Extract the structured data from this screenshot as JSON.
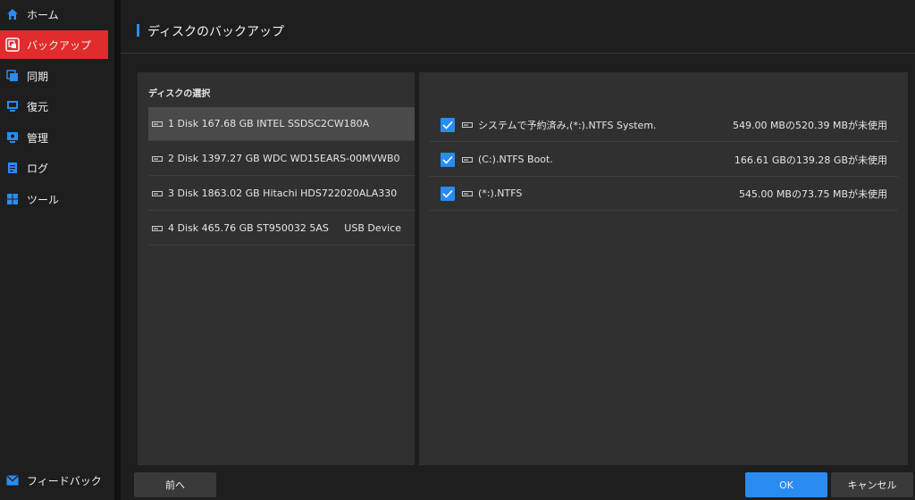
{
  "sidebar": {
    "items": [
      {
        "label": "ホーム",
        "icon": "home-icon",
        "active": false
      },
      {
        "label": "バックアップ",
        "icon": "backup-icon",
        "active": true
      },
      {
        "label": "同期",
        "icon": "sync-icon",
        "active": false
      },
      {
        "label": "復元",
        "icon": "restore-icon",
        "active": false
      },
      {
        "label": "管理",
        "icon": "manage-icon",
        "active": false
      },
      {
        "label": "ログ",
        "icon": "log-icon",
        "active": false
      },
      {
        "label": "ツール",
        "icon": "tools-icon",
        "active": false
      }
    ],
    "feedback_label": "フィードバック"
  },
  "header": {
    "title": "ディスクのバックアップ"
  },
  "disk_panel": {
    "title": "ディスクの選択",
    "disks": [
      {
        "label": "1 Disk 167.68 GB INTEL SSDSC2CW180A",
        "extra": "",
        "selected": true
      },
      {
        "label": "2 Disk 1397.27 GB WDC WD15EARS-00MVWB0",
        "extra": "",
        "selected": false
      },
      {
        "label": "3 Disk 1863.02 GB Hitachi HDS722020ALA330",
        "extra": "",
        "selected": false
      },
      {
        "label": "4 Disk 465.76 GB ST950032 5AS",
        "extra": "USB Device",
        "selected": false
      }
    ]
  },
  "partition_panel": {
    "partitions": [
      {
        "label": "システムで予約済み,(*:).NTFS System.",
        "usage": "549.00 MBの520.39 MBが未使用",
        "checked": true
      },
      {
        "label": "(C:).NTFS Boot.",
        "usage": "166.61 GBの139.28 GBが未使用",
        "checked": true
      },
      {
        "label": "(*:).NTFS",
        "usage": "545.00 MBの73.75 MBが未使用",
        "checked": true
      }
    ]
  },
  "footer": {
    "back_label": "前へ",
    "ok_label": "OK",
    "cancel_label": "キャンセル"
  },
  "colors": {
    "accent": "#2a8cf0",
    "active_nav": "#e02c2c",
    "background": "#1e1e1e",
    "panel": "#303030"
  }
}
